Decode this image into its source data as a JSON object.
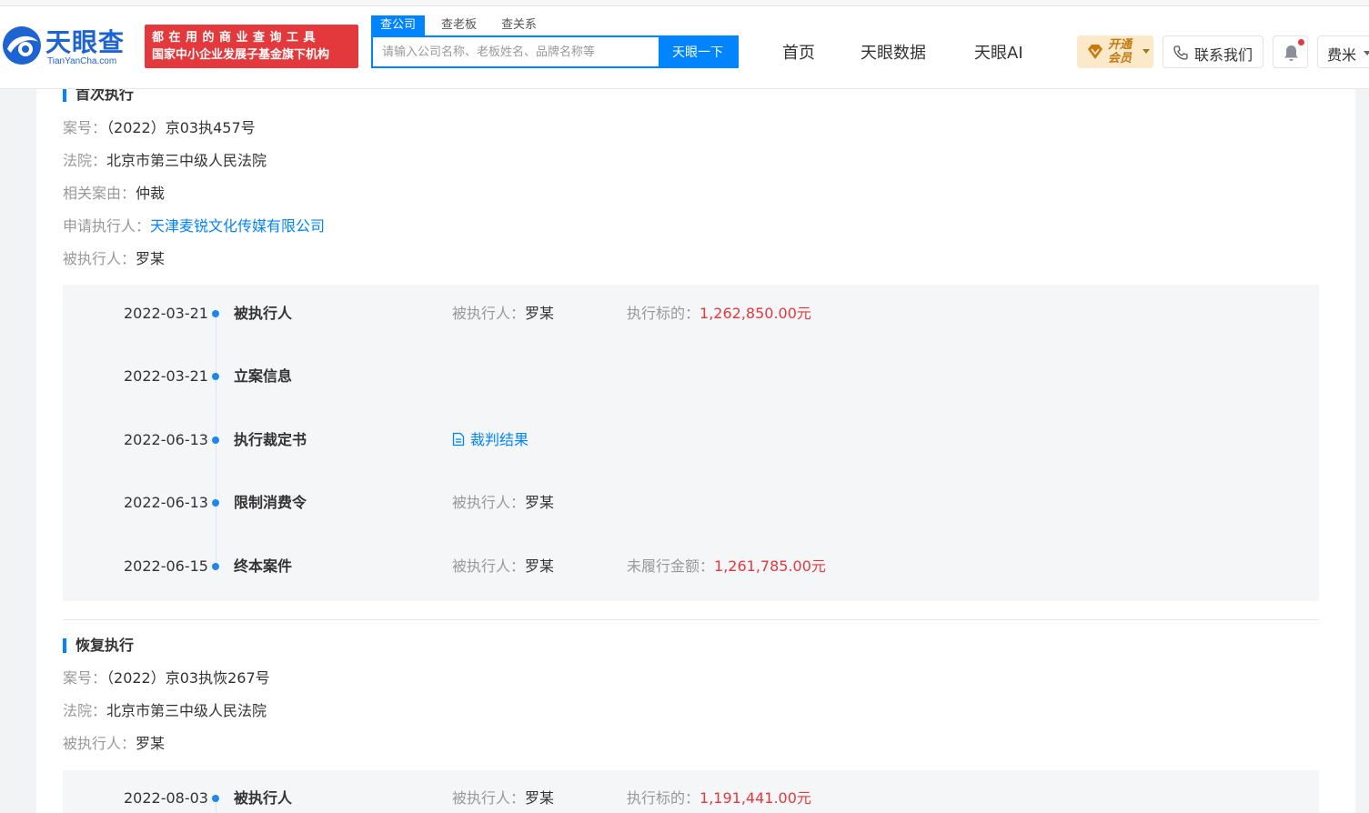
{
  "header": {
    "logo_cn": "天眼查",
    "logo_en": "TianYanCha.com",
    "slogan_line1": "都在用的商业查询工具",
    "slogan_line2": "国家中小企业发展子基金旗下机构",
    "search_tabs": [
      "查公司",
      "查老板",
      "查关系"
    ],
    "search_placeholder": "请输入公司名称、老板姓名、品牌名称等",
    "search_button": "天眼一下",
    "nav": [
      "首页",
      "天眼数据",
      "天眼AI"
    ],
    "vip_label_line1": "开通",
    "vip_label_line2": "会员",
    "contact_label": "联系我们",
    "user_name": "费米"
  },
  "first_execution": {
    "title": "首次执行",
    "fields": [
      {
        "key": "案号：",
        "value": "（2022）京03执457号"
      },
      {
        "key": "法院：",
        "value": "北京市第三中级人民法院"
      },
      {
        "key": "相关案由：",
        "value": "仲裁"
      },
      {
        "key": "申请执行人：",
        "value": "天津麦锐文化传媒有限公司"
      },
      {
        "key": "被执行人：",
        "value": "罗某"
      }
    ],
    "timeline": [
      {
        "date": "2022-03-21",
        "event": "被执行人",
        "c1_key": "被执行人：",
        "c1_val": "罗某",
        "c2_key": "执行标的：",
        "c2_val": "1,262,850.00元"
      },
      {
        "date": "2022-03-21",
        "event": "立案信息"
      },
      {
        "date": "2022-06-13",
        "event": "执行裁定书",
        "doc": "裁判结果"
      },
      {
        "date": "2022-06-13",
        "event": "限制消费令",
        "c1_key": "被执行人：",
        "c1_val": "罗某"
      },
      {
        "date": "2022-06-15",
        "event": "终本案件",
        "c1_key": "被执行人：",
        "c1_val": "罗某",
        "c2_key": "未履行金额：",
        "c2_val": "1,261,785.00元"
      }
    ]
  },
  "resumed_execution": {
    "title": "恢复执行",
    "fields": [
      {
        "key": "案号：",
        "value": "（2022）京03执恢267号"
      },
      {
        "key": "法院：",
        "value": "北京市第三中级人民法院"
      },
      {
        "key": "被执行人：",
        "value": "罗某"
      }
    ],
    "timeline": [
      {
        "date": "2022-08-03",
        "event": "被执行人",
        "c1_key": "被执行人：",
        "c1_val": "罗某",
        "c2_key": "执行标的：",
        "c2_val": "1,191,441.00元"
      }
    ]
  },
  "colors": {
    "brand_blue": "#0084ff",
    "amount_red": "#e4393c",
    "slogan_red": "#e4393c",
    "timeline_dot": "#1e86f0"
  }
}
